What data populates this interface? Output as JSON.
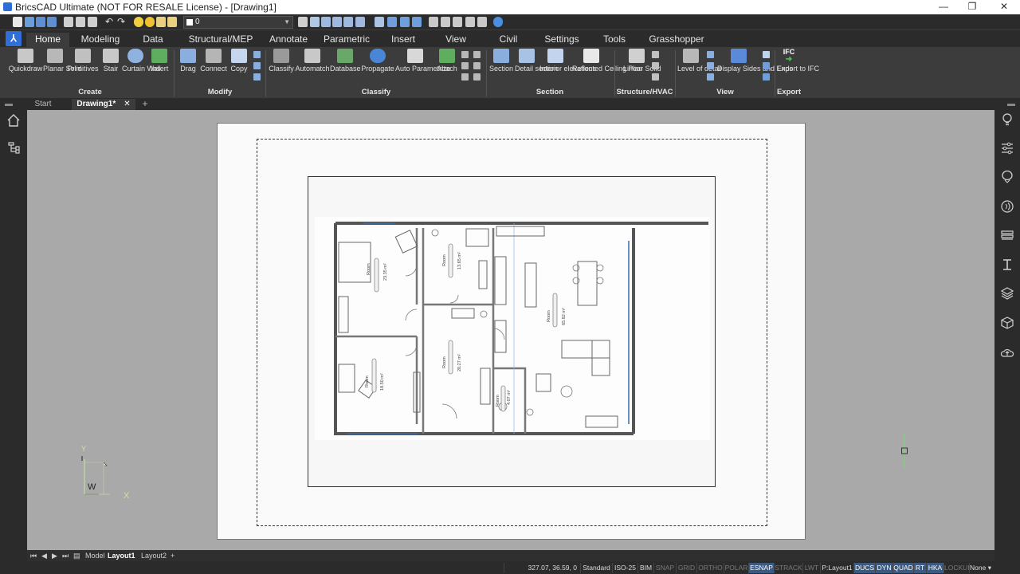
{
  "window": {
    "title": "BricsCAD Ultimate (NOT FOR RESALE License) - [Drawing1]",
    "min": "—",
    "restore": "❐",
    "close": "✕"
  },
  "quick_access": {
    "layer_value": "0"
  },
  "menu_tabs": [
    "Home",
    "Modeling",
    "Data",
    "Structural/MEP",
    "Annotate",
    "Parametric",
    "Insert",
    "View",
    "Civil",
    "Settings",
    "Tools",
    "Grasshopper"
  ],
  "ribbon": {
    "create": {
      "label": "Create",
      "buttons": [
        "Quickdraw",
        "Planar\nSolid",
        "Primitives",
        "Stair",
        "Curtain\nWall",
        "Insert"
      ]
    },
    "modify": {
      "label": "Modify",
      "buttons": [
        "Drag",
        "Connect",
        "Copy"
      ]
    },
    "classify": {
      "label": "Classify",
      "buttons": [
        "Classify",
        "Automatch",
        "Database",
        "Propagate",
        "Auto\nParametrize",
        "Attach"
      ]
    },
    "section": {
      "label": "Section",
      "buttons": [
        "Section",
        "Detail\nsection",
        "Interior\nelevations",
        "Reflected\nCeiling Plan"
      ]
    },
    "structure": {
      "label": "Structure/HVAC",
      "buttons": [
        "Linear\nSolid"
      ]
    },
    "view": {
      "label": "View",
      "buttons": [
        "Level of\ndetail",
        "Display Sides\nand Ends"
      ]
    },
    "export": {
      "label": "Export",
      "buttons": [
        "Export\nto IFC"
      ],
      "ifc_text": "IFC"
    }
  },
  "doc_tabs": {
    "start": "Start",
    "drawing": "Drawing1*",
    "add": "+"
  },
  "plan_rooms": [
    {
      "name": "Room",
      "area": "23.35 m²"
    },
    {
      "name": "Room",
      "area": "13.65 m²"
    },
    {
      "name": "Room",
      "area": "65.82 m²"
    },
    {
      "name": "Room",
      "area": "18.50 m²"
    },
    {
      "name": "Room",
      "area": "20.27 m²"
    },
    {
      "name": "Room",
      "area": "4.07 m²"
    }
  ],
  "ucs": {
    "y": "Y",
    "x": "X",
    "w": "W"
  },
  "layout_tabs": [
    "Model",
    "Layout1",
    "Layout2",
    "+"
  ],
  "status": {
    "coords": "327.07, 36.59, 0",
    "items": [
      "Standard",
      "ISO-25",
      "BIM",
      "SNAP",
      "GRID",
      "ORTHO",
      "POLAR",
      "ESNAP",
      "STRACK",
      "LWT",
      "P:Layout1",
      "DUCS",
      "DYN",
      "QUAD",
      "RT",
      "HKA",
      "LOCKUI",
      "None"
    ]
  }
}
